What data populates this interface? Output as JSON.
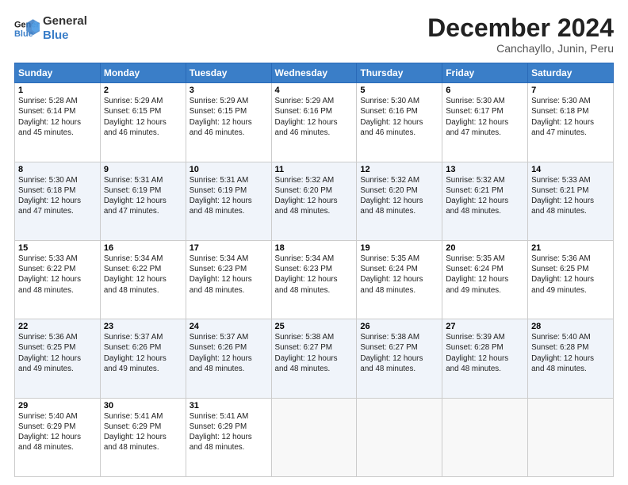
{
  "logo": {
    "line1": "General",
    "line2": "Blue"
  },
  "title": "December 2024",
  "location": "Canchayllo, Junin, Peru",
  "days_of_week": [
    "Sunday",
    "Monday",
    "Tuesday",
    "Wednesday",
    "Thursday",
    "Friday",
    "Saturday"
  ],
  "weeks": [
    [
      {
        "day": "1",
        "sunrise": "5:28 AM",
        "sunset": "6:14 PM",
        "daylight": "12 hours and 45 minutes."
      },
      {
        "day": "2",
        "sunrise": "5:29 AM",
        "sunset": "6:15 PM",
        "daylight": "12 hours and 46 minutes."
      },
      {
        "day": "3",
        "sunrise": "5:29 AM",
        "sunset": "6:15 PM",
        "daylight": "12 hours and 46 minutes."
      },
      {
        "day": "4",
        "sunrise": "5:29 AM",
        "sunset": "6:16 PM",
        "daylight": "12 hours and 46 minutes."
      },
      {
        "day": "5",
        "sunrise": "5:30 AM",
        "sunset": "6:16 PM",
        "daylight": "12 hours and 46 minutes."
      },
      {
        "day": "6",
        "sunrise": "5:30 AM",
        "sunset": "6:17 PM",
        "daylight": "12 hours and 47 minutes."
      },
      {
        "day": "7",
        "sunrise": "5:30 AM",
        "sunset": "6:18 PM",
        "daylight": "12 hours and 47 minutes."
      }
    ],
    [
      {
        "day": "8",
        "sunrise": "5:30 AM",
        "sunset": "6:18 PM",
        "daylight": "12 hours and 47 minutes."
      },
      {
        "day": "9",
        "sunrise": "5:31 AM",
        "sunset": "6:19 PM",
        "daylight": "12 hours and 47 minutes."
      },
      {
        "day": "10",
        "sunrise": "5:31 AM",
        "sunset": "6:19 PM",
        "daylight": "12 hours and 48 minutes."
      },
      {
        "day": "11",
        "sunrise": "5:32 AM",
        "sunset": "6:20 PM",
        "daylight": "12 hours and 48 minutes."
      },
      {
        "day": "12",
        "sunrise": "5:32 AM",
        "sunset": "6:20 PM",
        "daylight": "12 hours and 48 minutes."
      },
      {
        "day": "13",
        "sunrise": "5:32 AM",
        "sunset": "6:21 PM",
        "daylight": "12 hours and 48 minutes."
      },
      {
        "day": "14",
        "sunrise": "5:33 AM",
        "sunset": "6:21 PM",
        "daylight": "12 hours and 48 minutes."
      }
    ],
    [
      {
        "day": "15",
        "sunrise": "5:33 AM",
        "sunset": "6:22 PM",
        "daylight": "12 hours and 48 minutes."
      },
      {
        "day": "16",
        "sunrise": "5:34 AM",
        "sunset": "6:22 PM",
        "daylight": "12 hours and 48 minutes."
      },
      {
        "day": "17",
        "sunrise": "5:34 AM",
        "sunset": "6:23 PM",
        "daylight": "12 hours and 48 minutes."
      },
      {
        "day": "18",
        "sunrise": "5:34 AM",
        "sunset": "6:23 PM",
        "daylight": "12 hours and 48 minutes."
      },
      {
        "day": "19",
        "sunrise": "5:35 AM",
        "sunset": "6:24 PM",
        "daylight": "12 hours and 48 minutes."
      },
      {
        "day": "20",
        "sunrise": "5:35 AM",
        "sunset": "6:24 PM",
        "daylight": "12 hours and 49 minutes."
      },
      {
        "day": "21",
        "sunrise": "5:36 AM",
        "sunset": "6:25 PM",
        "daylight": "12 hours and 49 minutes."
      }
    ],
    [
      {
        "day": "22",
        "sunrise": "5:36 AM",
        "sunset": "6:25 PM",
        "daylight": "12 hours and 49 minutes."
      },
      {
        "day": "23",
        "sunrise": "5:37 AM",
        "sunset": "6:26 PM",
        "daylight": "12 hours and 49 minutes."
      },
      {
        "day": "24",
        "sunrise": "5:37 AM",
        "sunset": "6:26 PM",
        "daylight": "12 hours and 48 minutes."
      },
      {
        "day": "25",
        "sunrise": "5:38 AM",
        "sunset": "6:27 PM",
        "daylight": "12 hours and 48 minutes."
      },
      {
        "day": "26",
        "sunrise": "5:38 AM",
        "sunset": "6:27 PM",
        "daylight": "12 hours and 48 minutes."
      },
      {
        "day": "27",
        "sunrise": "5:39 AM",
        "sunset": "6:28 PM",
        "daylight": "12 hours and 48 minutes."
      },
      {
        "day": "28",
        "sunrise": "5:40 AM",
        "sunset": "6:28 PM",
        "daylight": "12 hours and 48 minutes."
      }
    ],
    [
      {
        "day": "29",
        "sunrise": "5:40 AM",
        "sunset": "6:29 PM",
        "daylight": "12 hours and 48 minutes."
      },
      {
        "day": "30",
        "sunrise": "5:41 AM",
        "sunset": "6:29 PM",
        "daylight": "12 hours and 48 minutes."
      },
      {
        "day": "31",
        "sunrise": "5:41 AM",
        "sunset": "6:29 PM",
        "daylight": "12 hours and 48 minutes."
      },
      null,
      null,
      null,
      null
    ]
  ]
}
